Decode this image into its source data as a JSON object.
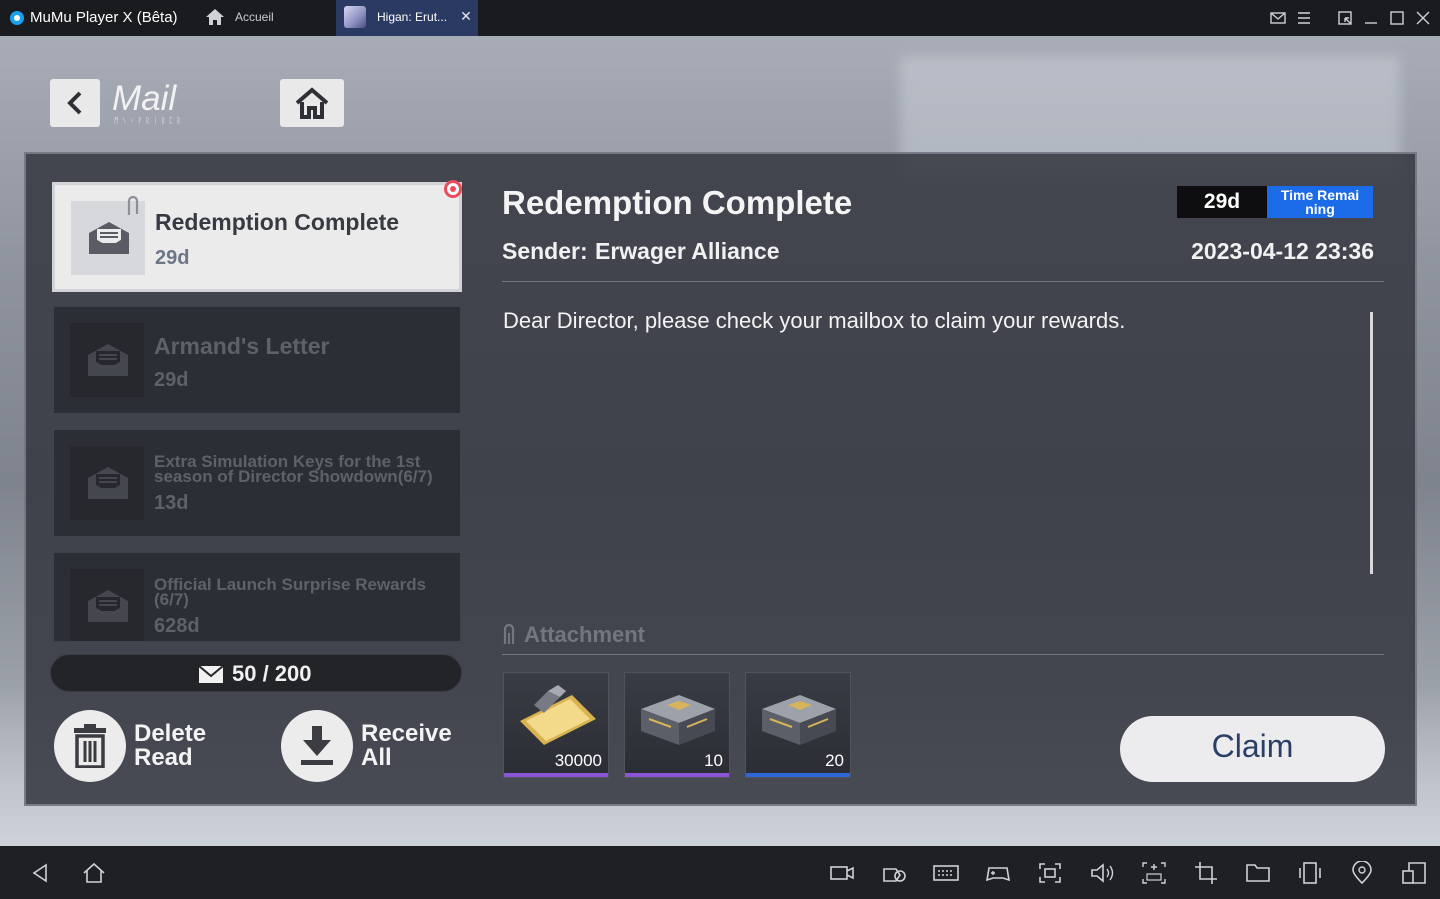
{
  "titlebar": {
    "app_title": "MuMu Player X  (Bêta)",
    "home_tab_label": "Accueil",
    "game_tab_label": "Higan: Erut...",
    "close_glyph": "✕",
    "icons": [
      "mail-icon",
      "menu-icon",
      "shrink-icon",
      "minimize-icon",
      "maximize-icon",
      "close-window-icon"
    ]
  },
  "header": {
    "title": "Mail",
    "subtitle": "ᛗᛊᚲᚹᚱᛁᛒᛈᚱ"
  },
  "mail_list": [
    {
      "subject": "Redemption Complete",
      "days": "29d",
      "active": true,
      "has_attachment": true,
      "unread": true
    },
    {
      "subject": "Armand's Letter",
      "days": "29d",
      "active": false
    },
    {
      "subject": "Extra Simulation Keys for the 1st season of Director Showdown(6/7)",
      "days": "13d",
      "active": false
    },
    {
      "subject": "Official Launch Surprise Rewards (6/7)",
      "days": "628d",
      "active": false
    }
  ],
  "mail_count": "50 / 200",
  "actions": {
    "delete_label": "Delete Read",
    "receive_label": "Receive All"
  },
  "detail": {
    "title": "Redemption Complete",
    "time_days": "29d",
    "time_label": "Time Remai ning",
    "sender_label": "Sender:",
    "sender_name": "Erwager Alliance",
    "date": "2023-04-12 23:36",
    "body": "Dear Director, please check your mailbox to claim your rewards.",
    "attachment_label": "Attachment",
    "attachments": [
      {
        "icon": "ticket-icon",
        "qty": "30000",
        "rarity_color": "#8b54d6"
      },
      {
        "icon": "supply-crate-icon",
        "qty": "10",
        "rarity_color": "#8b54d6"
      },
      {
        "icon": "supply-crate-icon",
        "qty": "20",
        "rarity_color": "#2f66d9"
      }
    ],
    "claim_label": "Claim"
  },
  "navbar": {
    "icons": [
      "back-icon",
      "home-icon",
      "camera-icon",
      "gamepad-record-icon",
      "keyboard-icon",
      "controller-icon",
      "screenshot-icon",
      "volume-icon",
      "apk-install-icon",
      "crop-icon",
      "folder-icon",
      "rotate-icon",
      "location-icon",
      "multi-window-icon"
    ]
  },
  "colors": {
    "accent_blue": "#1c6be8",
    "unread_red": "#ec4b5c",
    "claim_text": "#2b3f66"
  }
}
